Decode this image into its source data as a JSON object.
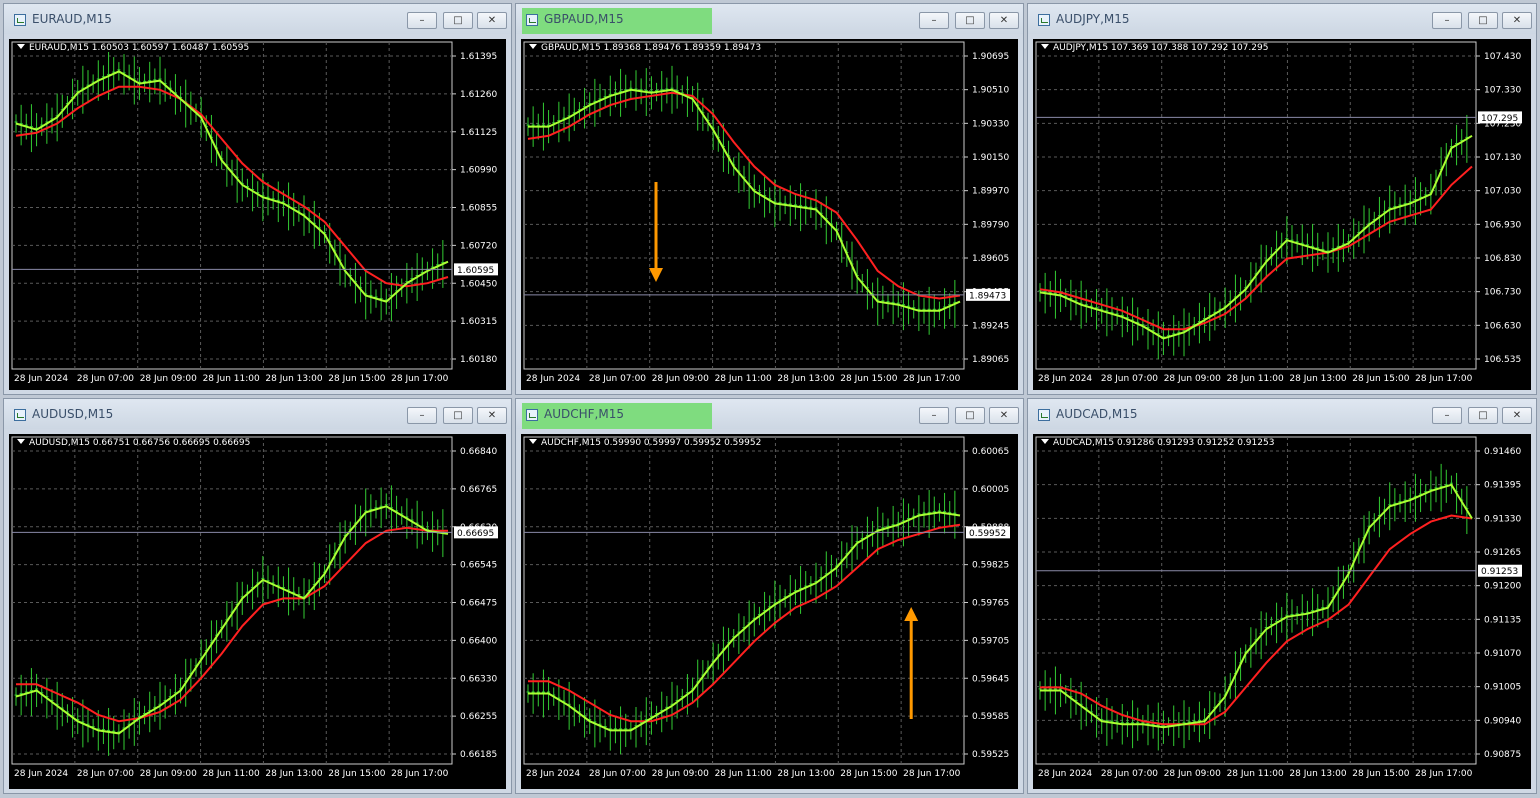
{
  "windows": [
    {
      "id": "euraud",
      "title": "EURAUD,M15",
      "highlight": false,
      "info": "EURAUD,M15  1.60503 1.60597 1.60487 1.60595",
      "yticks": [
        "1.61395",
        "1.61260",
        "1.61125",
        "1.60990",
        "1.60855",
        "1.60720",
        "1.60450",
        "1.60315",
        "1.60180"
      ],
      "price": "1.60595",
      "xticks": [
        "28 Jun 2024",
        "28 Jun 07:00",
        "28 Jun 09:00",
        "28 Jun 11:00",
        "28 Jun 13:00",
        "28 Jun 15:00",
        "28 Jun 17:00"
      ],
      "arrow": "none"
    },
    {
      "id": "gbpaud",
      "title": "GBPAUD,M15",
      "highlight": true,
      "info": "GBPAUD,M15  1.89368 1.89476 1.89359 1.89473",
      "yticks": [
        "1.90695",
        "1.90510",
        "1.90330",
        "1.90150",
        "1.89970",
        "1.89790",
        "1.89605",
        "1.89425",
        "1.89245",
        "1.89065"
      ],
      "price": "1.89473",
      "xticks": [
        "28 Jun 2024",
        "28 Jun 07:00",
        "28 Jun 09:00",
        "28 Jun 11:00",
        "28 Jun 13:00",
        "28 Jun 15:00",
        "28 Jun 17:00"
      ],
      "arrow": "down"
    },
    {
      "id": "audjpy",
      "title": "AUDJPY,M15",
      "highlight": false,
      "info": "AUDJPY,M15  107.369 107.388 107.292 107.295",
      "yticks": [
        "107.430",
        "107.330",
        "107.230",
        "107.130",
        "107.030",
        "106.930",
        "106.830",
        "106.730",
        "106.630",
        "106.535"
      ],
      "price": "107.295",
      "xticks": [
        "28 Jun 2024",
        "28 Jun 07:00",
        "28 Jun 09:00",
        "28 Jun 11:00",
        "28 Jun 13:00",
        "28 Jun 15:00",
        "28 Jun 17:00"
      ],
      "arrow": "none"
    },
    {
      "id": "audusd",
      "title": "AUDUSD,M15",
      "highlight": false,
      "info": "AUDUSD,M15  0.66751 0.66756 0.66695 0.66695",
      "yticks": [
        "0.66840",
        "0.66765",
        "0.66620",
        "0.66545",
        "0.66475",
        "0.66400",
        "0.66330",
        "0.66255",
        "0.66185"
      ],
      "price": "0.66695",
      "xticks": [
        "28 Jun 2024",
        "28 Jun 07:00",
        "28 Jun 09:00",
        "28 Jun 11:00",
        "28 Jun 13:00",
        "28 Jun 15:00",
        "28 Jun 17:00"
      ],
      "arrow": "none"
    },
    {
      "id": "audchf",
      "title": "AUDCHF,M15",
      "highlight": true,
      "info": "AUDCHF,M15  0.59990 0.59997 0.59952 0.59952",
      "yticks": [
        "0.60065",
        "0.60005",
        "0.59888",
        "0.59825",
        "0.59765",
        "0.59705",
        "0.59645",
        "0.59585",
        "0.59525"
      ],
      "price": "0.59952",
      "xticks": [
        "28 Jun 2024",
        "28 Jun 07:00",
        "28 Jun 09:00",
        "28 Jun 11:00",
        "28 Jun 13:00",
        "28 Jun 15:00",
        "28 Jun 17:00"
      ],
      "arrow": "up"
    },
    {
      "id": "audcad",
      "title": "AUDCAD,M15",
      "highlight": false,
      "info": "AUDCAD,M15  0.91286 0.91293 0.91252 0.91253",
      "yticks": [
        "0.91460",
        "0.91395",
        "0.91330",
        "0.91265",
        "0.91200",
        "0.91135",
        "0.91070",
        "0.91005",
        "0.90940",
        "0.90875"
      ],
      "price": "0.91253",
      "xticks": [
        "28 Jun 2024",
        "28 Jun 07:00",
        "28 Jun 09:00",
        "28 Jun 11:00",
        "28 Jun 13:00",
        "28 Jun 15:00",
        "28 Jun 17:00"
      ],
      "arrow": "none"
    }
  ],
  "buttons": {
    "minimize": "–",
    "maximize": "□",
    "close": "✕"
  },
  "colors": {
    "background": "#000000",
    "grid": "#5a5a5a",
    "candles": "#33cc33",
    "ema_fast": "#aaff33",
    "ema_slow": "#ff2020",
    "arrow": "#ff9900",
    "price_line": "#8a8aa8"
  }
}
